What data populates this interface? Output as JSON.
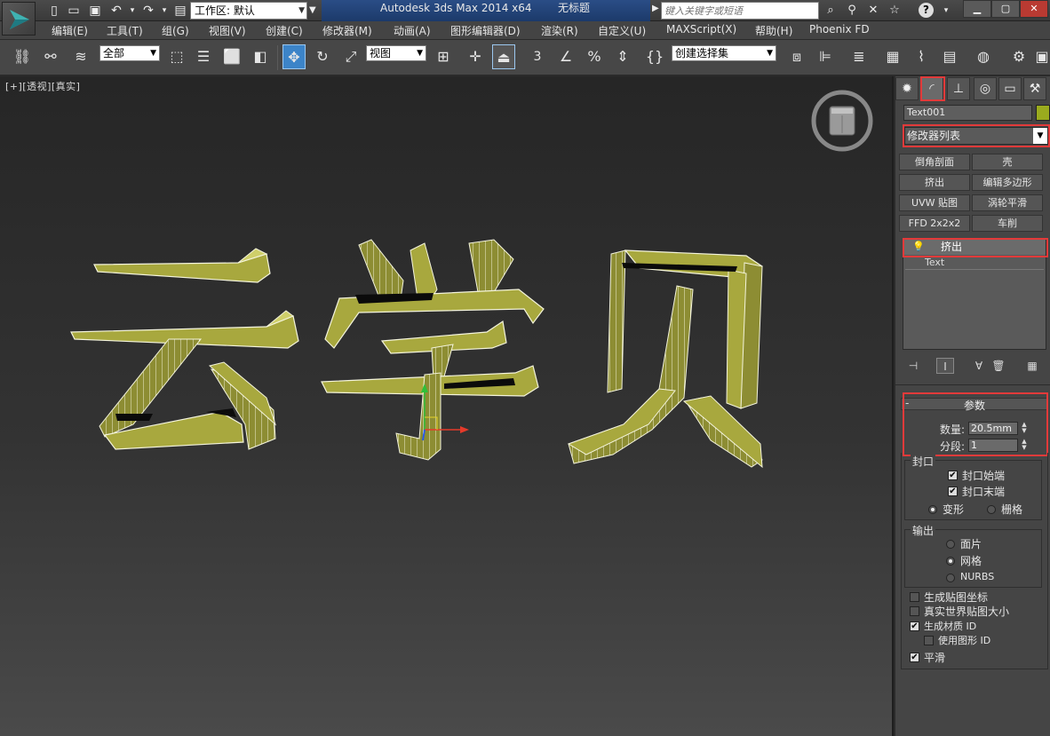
{
  "titlebar": {
    "workspace": "工作区: 默认",
    "app_name": "Autodesk 3ds Max  2014 x64",
    "doc_name": "无标题",
    "search_placeholder": "键入关键字或短语",
    "help": "?"
  },
  "menu": [
    "编辑(E)",
    "工具(T)",
    "组(G)",
    "视图(V)",
    "创建(C)",
    "修改器(M)",
    "动画(A)",
    "图形编辑器(D)",
    "渲染(R)",
    "自定义(U)",
    "MAXScript(X)",
    "帮助(H)",
    "Phoenix FD"
  ],
  "toolbar": {
    "selection_filter": "全部",
    "ref_coord": "视图",
    "snap_label": "3",
    "named_selection": "创建选择集"
  },
  "viewport": {
    "label": "[+][透视][真实]",
    "text_object": "云学贝",
    "object_color": "#a7a73f"
  },
  "panel": {
    "object_name": "Text001",
    "modifier_list": "修改器列表",
    "modifier_buttons": [
      "倒角剖面",
      "壳",
      "挤出",
      "编辑多边形",
      "UVW 贴图",
      "涡轮平滑",
      "FFD 2x2x2",
      "车削"
    ],
    "stack_items": [
      "挤出",
      "Text"
    ],
    "params_title": "参数",
    "rollup_minus": "-",
    "amount_label": "数量:",
    "amount_value": "20.5mm",
    "segments_label": "分段:",
    "segments_value": "1",
    "capping": {
      "title": "封口",
      "cap_start": "封口始端",
      "cap_end": "封口末端",
      "morph": "变形",
      "grid": "栅格"
    },
    "output": {
      "title": "输出",
      "patch": "面片",
      "mesh": "网格",
      "nurbs": "NURBS"
    },
    "options": {
      "gen_mapping": "生成贴图坐标",
      "real_world": "真实世界贴图大小",
      "gen_matid": "生成材质 ID",
      "use_shape_ids": "使用图形 ID",
      "smooth": "平滑"
    }
  },
  "colors": {
    "highlight": "#e23a3a",
    "active_tool": "#3c84c8",
    "title_blue": "#2a4d86"
  }
}
